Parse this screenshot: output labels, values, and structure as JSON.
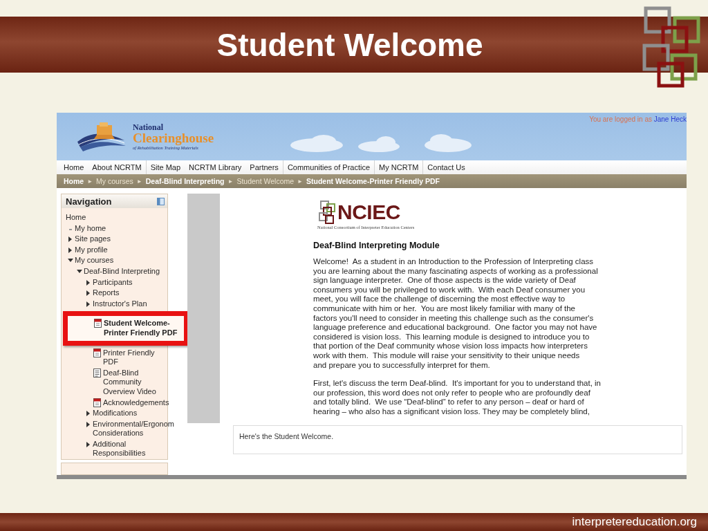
{
  "slide": {
    "title": "Student Welcome",
    "footer": "interpretereducation.org"
  },
  "site": {
    "logo": {
      "line1": "National",
      "line2": "Clearinghouse",
      "line3": "of Rehabilitation Training Materials"
    },
    "login": {
      "prefix": "You are logged in as",
      "user": "Jane Heck"
    },
    "menu": [
      {
        "label": "Home",
        "divider": false
      },
      {
        "label": "About NCRTM",
        "divider": true
      },
      {
        "label": "Site Map",
        "divider": false
      },
      {
        "label": "NCRTM Library",
        "divider": false
      },
      {
        "label": "Partners",
        "divider": true
      },
      {
        "label": "Communities of Practice",
        "divider": true
      },
      {
        "label": "My NCRTM",
        "divider": true
      },
      {
        "label": "Contact Us",
        "divider": false
      }
    ],
    "breadcrumb": [
      {
        "label": "Home",
        "dim": false
      },
      {
        "sep": "►",
        "label": "My courses",
        "dim": true
      },
      {
        "sep": "►",
        "label": "Deaf-Blind Interpreting",
        "dim": false
      },
      {
        "sep": "►",
        "label": "Student Welcome",
        "dim": true
      },
      {
        "sep": "►",
        "label": "Student Welcome-Printer Friendly PDF",
        "dim": false
      }
    ]
  },
  "navigation": {
    "title": "Navigation",
    "items": [
      {
        "kind": "link",
        "label": "Home"
      },
      {
        "kind": "bullet",
        "label": "My home"
      },
      {
        "kind": "branch",
        "label": "Site pages",
        "expanded": false
      },
      {
        "kind": "branch",
        "label": "My profile",
        "expanded": false
      },
      {
        "kind": "branch",
        "label": "My courses",
        "expanded": true,
        "children": [
          {
            "kind": "branch",
            "label": "Deaf-Blind Interpreting",
            "expanded": true,
            "children": [
              {
                "kind": "branch",
                "label": "Participants",
                "expanded": false
              },
              {
                "kind": "branch",
                "label": "Reports",
                "expanded": false
              },
              {
                "kind": "branch",
                "label": "Instructor's Plan",
                "expanded": false
              },
              {
                "kind": "callout",
                "label": "Student Welcome-Printer Friendly PDF"
              },
              {
                "kind": "pdf",
                "label": "Printer Friendly PDF"
              },
              {
                "kind": "doc",
                "label": "Deaf-Blind Community Overview Video"
              },
              {
                "kind": "pdf",
                "label": "Acknowledgements"
              },
              {
                "kind": "branch",
                "label": "Modifications",
                "expanded": false
              },
              {
                "kind": "branch",
                "label": "Environmental/Ergonom Considerations",
                "expanded": false
              },
              {
                "kind": "branch",
                "label": "Additional Responsibilities",
                "expanded": false
              }
            ]
          }
        ]
      }
    ]
  },
  "document": {
    "logo": {
      "name": "NCIEC",
      "subtitle": "National Consortium of Interpreter Education Centers"
    },
    "heading": "Deaf-Blind Interpreting Module",
    "paragraphs": [
      [
        "Welcome!  As a student in an Introduction to the Profession of Interpreting class",
        "you are learning about the many fascinating aspects of working as a professional",
        "sign language interpreter.  One of those aspects is the wide variety of Deaf",
        "consumers you will be privileged to work with.  With each Deaf consumer you",
        "meet, you will face the challenge of discerning the most effective way to",
        "communicate with him or her.  You are most likely familiar with many of the",
        "factors you'll need to consider in meeting this challenge such as the consumer's",
        "language preference and educational background.  One factor you may not have",
        "considered is vision loss.  This learning module is designed to introduce you to",
        "that portion of the Deaf community whose vision loss impacts how interpreters",
        "work with them.  This module will raise your sensitivity to their unique needs",
        "and prepare you to successfully interpret for them."
      ],
      [
        "First, let's discuss the term Deaf-blind.  It's important for you to understand that, in",
        "our profession, this word does not only refer to people who are profoundly deaf",
        "and totally blind.  We use “Deaf-blind” to refer to any person – deaf or hard of",
        "hearing – who also has a significant vision loss. They may be completely blind,"
      ]
    ]
  },
  "comment": "Here's the Student Welcome."
}
